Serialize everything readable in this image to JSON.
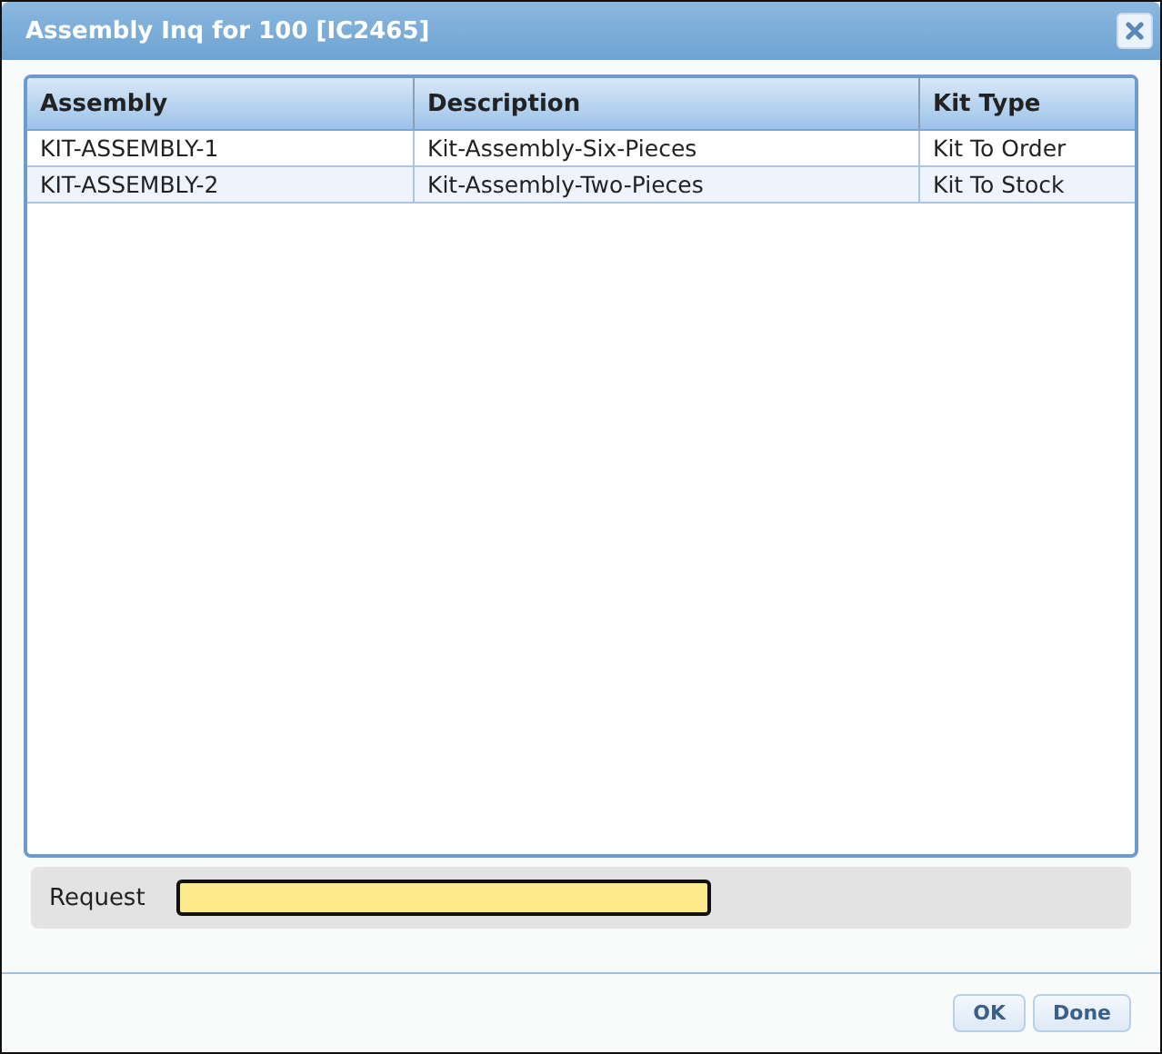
{
  "window": {
    "title": "Assembly Inq for 100 [IC2465]"
  },
  "table": {
    "columns": [
      "Assembly",
      "Description",
      "Kit Type"
    ],
    "rows": [
      [
        "KIT-ASSEMBLY-1",
        "Kit-Assembly-Six-Pieces",
        "Kit To Order"
      ],
      [
        "KIT-ASSEMBLY-2",
        "Kit-Assembly-Two-Pieces",
        "Kit To Stock"
      ]
    ]
  },
  "request": {
    "label": "Request"
  },
  "buttons": [
    "OK",
    "Done"
  ]
}
